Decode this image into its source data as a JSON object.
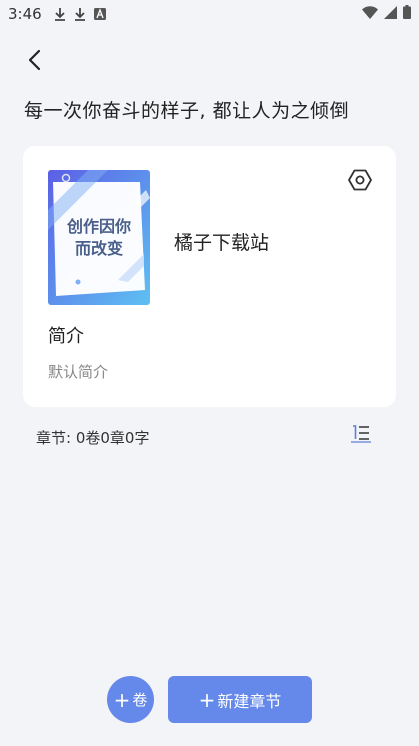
{
  "status_bar": {
    "time": "3:46",
    "icons": [
      "download-icon",
      "download-icon",
      "a-box-icon",
      "wifi-icon",
      "signal-icon",
      "battery-icon"
    ]
  },
  "header": {
    "slogan": "每一次你奋斗的样子, 都让人为之倾倒"
  },
  "book": {
    "title": "橘子下载站",
    "cover_text_line1": "创作因你",
    "cover_text_line2": "而改变",
    "intro_heading": "简介",
    "intro_text": "默认简介"
  },
  "chapters": {
    "stats": "章节: 0卷0章0字"
  },
  "actions": {
    "add_volume_label": "卷",
    "add_chapter_label": "新建章节"
  },
  "colors": {
    "background": "#f3f4f8",
    "card": "#ffffff",
    "accent": "#6589ea",
    "muted_text": "#888888"
  }
}
